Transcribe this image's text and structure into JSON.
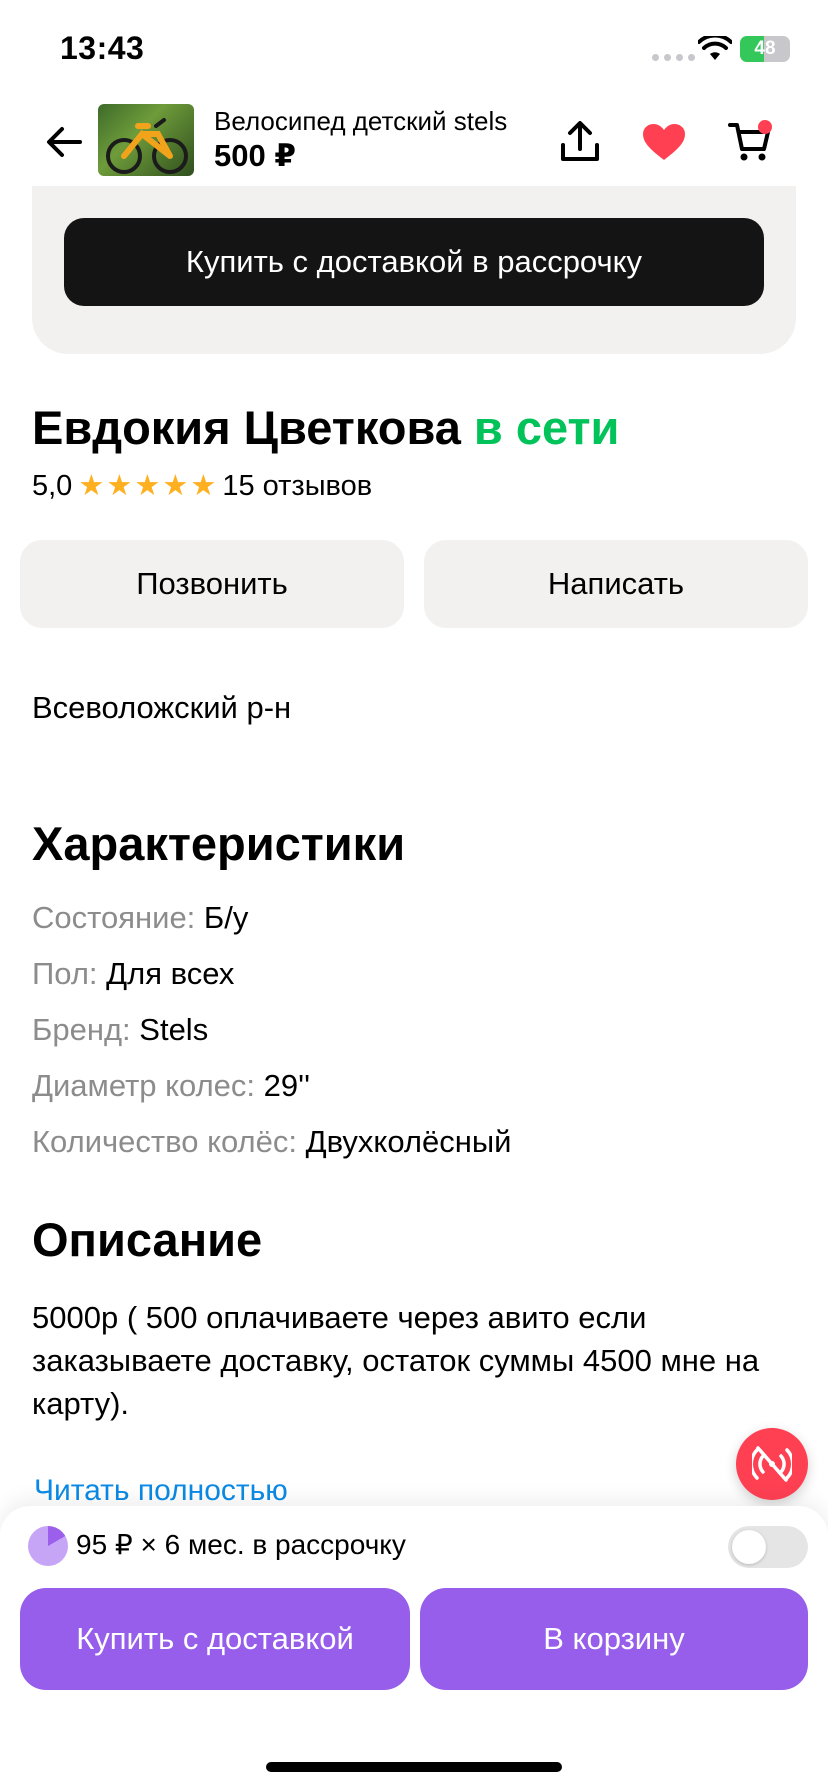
{
  "status_bar": {
    "time": "13:43",
    "battery_percent": "48",
    "battery_level": 0.48
  },
  "header": {
    "product_title": "Велосипед детский stels",
    "price": "500 ₽"
  },
  "card": {
    "button_label": "Купить с доставкой в рассрочку"
  },
  "seller": {
    "name": "Евдокия Цветкова",
    "status": "в сети",
    "rating": "5,0",
    "stars": 5,
    "reviews": "15 отзывов",
    "call_label": "Позвонить",
    "message_label": "Написать"
  },
  "location": "Всеволожский р-н",
  "specs": {
    "title": "Характеристики",
    "items": [
      {
        "key": "Состояние:",
        "value": "Б/у"
      },
      {
        "key": "Пол:",
        "value": "Для всех"
      },
      {
        "key": "Бренд:",
        "value": "Stels"
      },
      {
        "key": "Диаметр колес:",
        "value": "29''"
      },
      {
        "key": "Количество колёс:",
        "value": "Двухколёсный"
      }
    ]
  },
  "description": {
    "title": "Описание",
    "text": "5000р ( 500 оплачиваете через авито если заказываете доставку, остаток суммы 4500 мне на карту).",
    "read_more": "Читать полностью"
  },
  "bottom": {
    "installment": "95 ₽ × 6 мес. в рассрочку",
    "installment_enabled": false,
    "buy_label": "Купить с доставкой",
    "cart_label": "В корзину"
  },
  "colors": {
    "accent_purple": "#965eeb",
    "online_green": "#02c25a",
    "heart_red": "#ff4053",
    "link_blue": "#0a8ae6",
    "star_orange": "#ffb021"
  }
}
